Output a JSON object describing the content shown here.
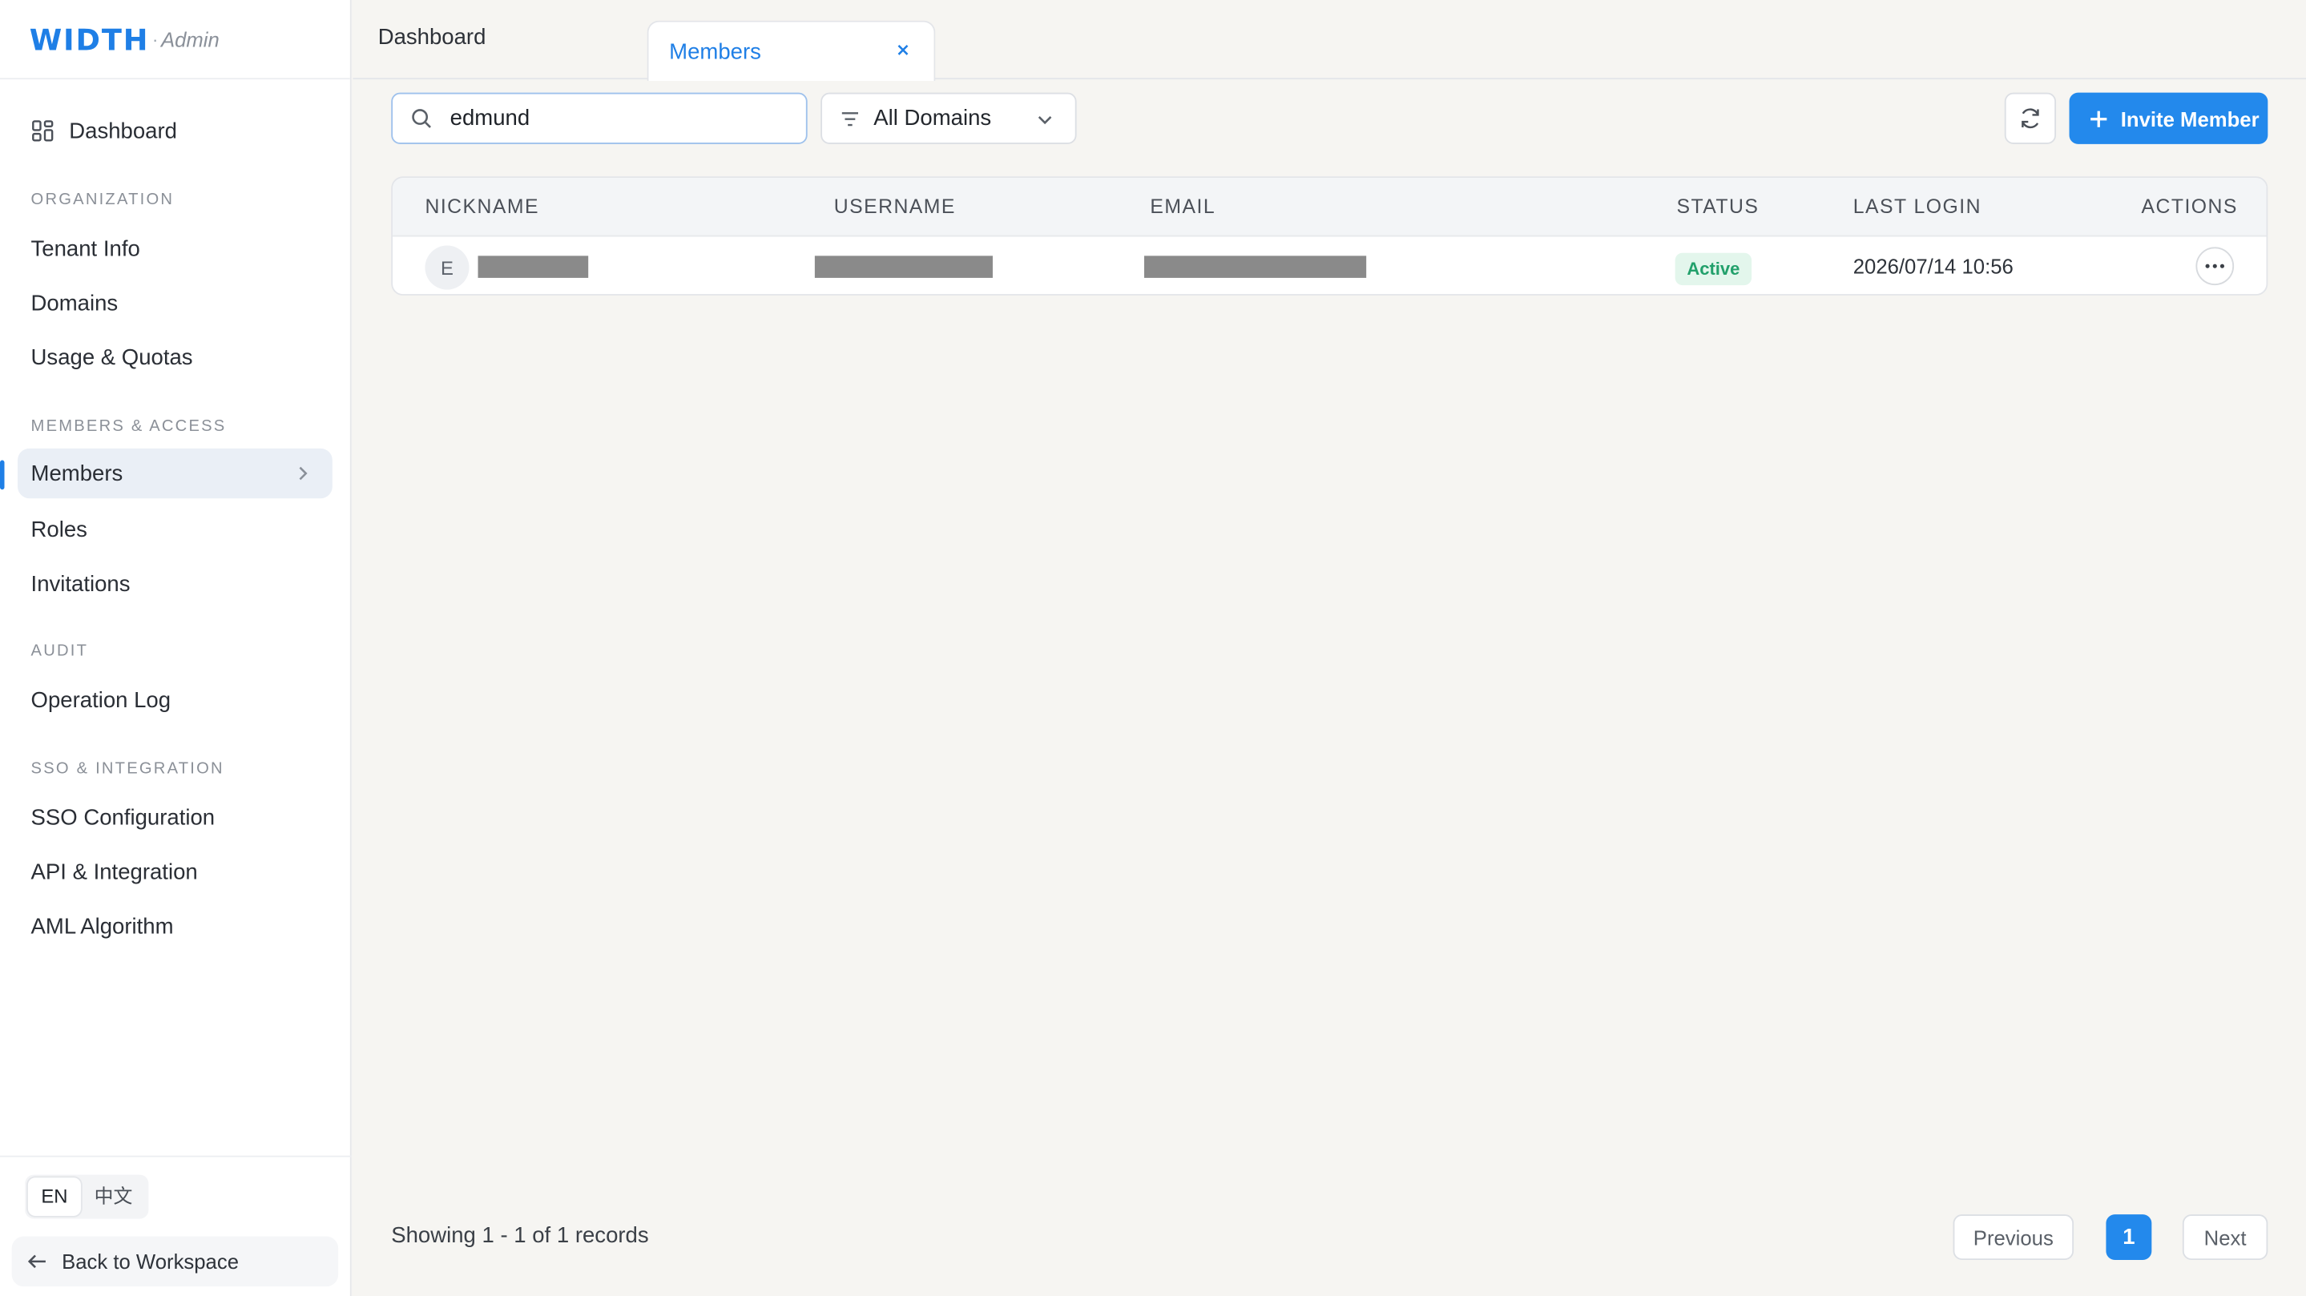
{
  "brand": {
    "logo": "WIDTH",
    "separator": "·",
    "subtitle": "Admin"
  },
  "sidebar": {
    "top_item": {
      "label": "Dashboard",
      "icon": "dashboard-grid-icon"
    },
    "sections": [
      {
        "title": "ORGANIZATION",
        "items": [
          "Tenant Info",
          "Domains",
          "Usage & Quotas"
        ]
      },
      {
        "title": "MEMBERS & ACCESS",
        "items": [
          "Members",
          "Roles",
          "Invitations"
        ]
      },
      {
        "title": "AUDIT",
        "items": [
          "Operation Log"
        ]
      },
      {
        "title": "SSO & INTEGRATION",
        "items": [
          "SSO Configuration",
          "API & Integration",
          "AML Algorithm"
        ]
      }
    ],
    "active_item": "Members",
    "languages": [
      {
        "label": "EN",
        "active": true
      },
      {
        "label": "中文",
        "active": false
      }
    ],
    "back_label": "Back to Workspace"
  },
  "tabs": [
    {
      "label": "Dashboard",
      "active": false
    },
    {
      "label": "Members",
      "active": true,
      "closable": true
    }
  ],
  "toolbar": {
    "search_value": "edmund",
    "filter_label": "All Domains",
    "invite_label": "Invite Member"
  },
  "table": {
    "columns": [
      "NICKNAME",
      "USERNAME",
      "EMAIL",
      "STATUS",
      "LAST LOGIN",
      "ACTIONS"
    ],
    "rows": [
      {
        "avatar_initial": "E",
        "nickname": "[redacted]",
        "username": "[redacted]",
        "email": "[redacted]",
        "status": "Active",
        "last_login": "2026/07/14 10:56"
      }
    ]
  },
  "footer": {
    "showing_text": "Showing 1 - 1 of 1 records",
    "previous_label": "Previous",
    "current_page": "1",
    "next_label": "Next"
  },
  "colors": {
    "accent": "#2389ec",
    "status_active": "#22a06b",
    "status_active_bg": "#e3f6ec"
  }
}
